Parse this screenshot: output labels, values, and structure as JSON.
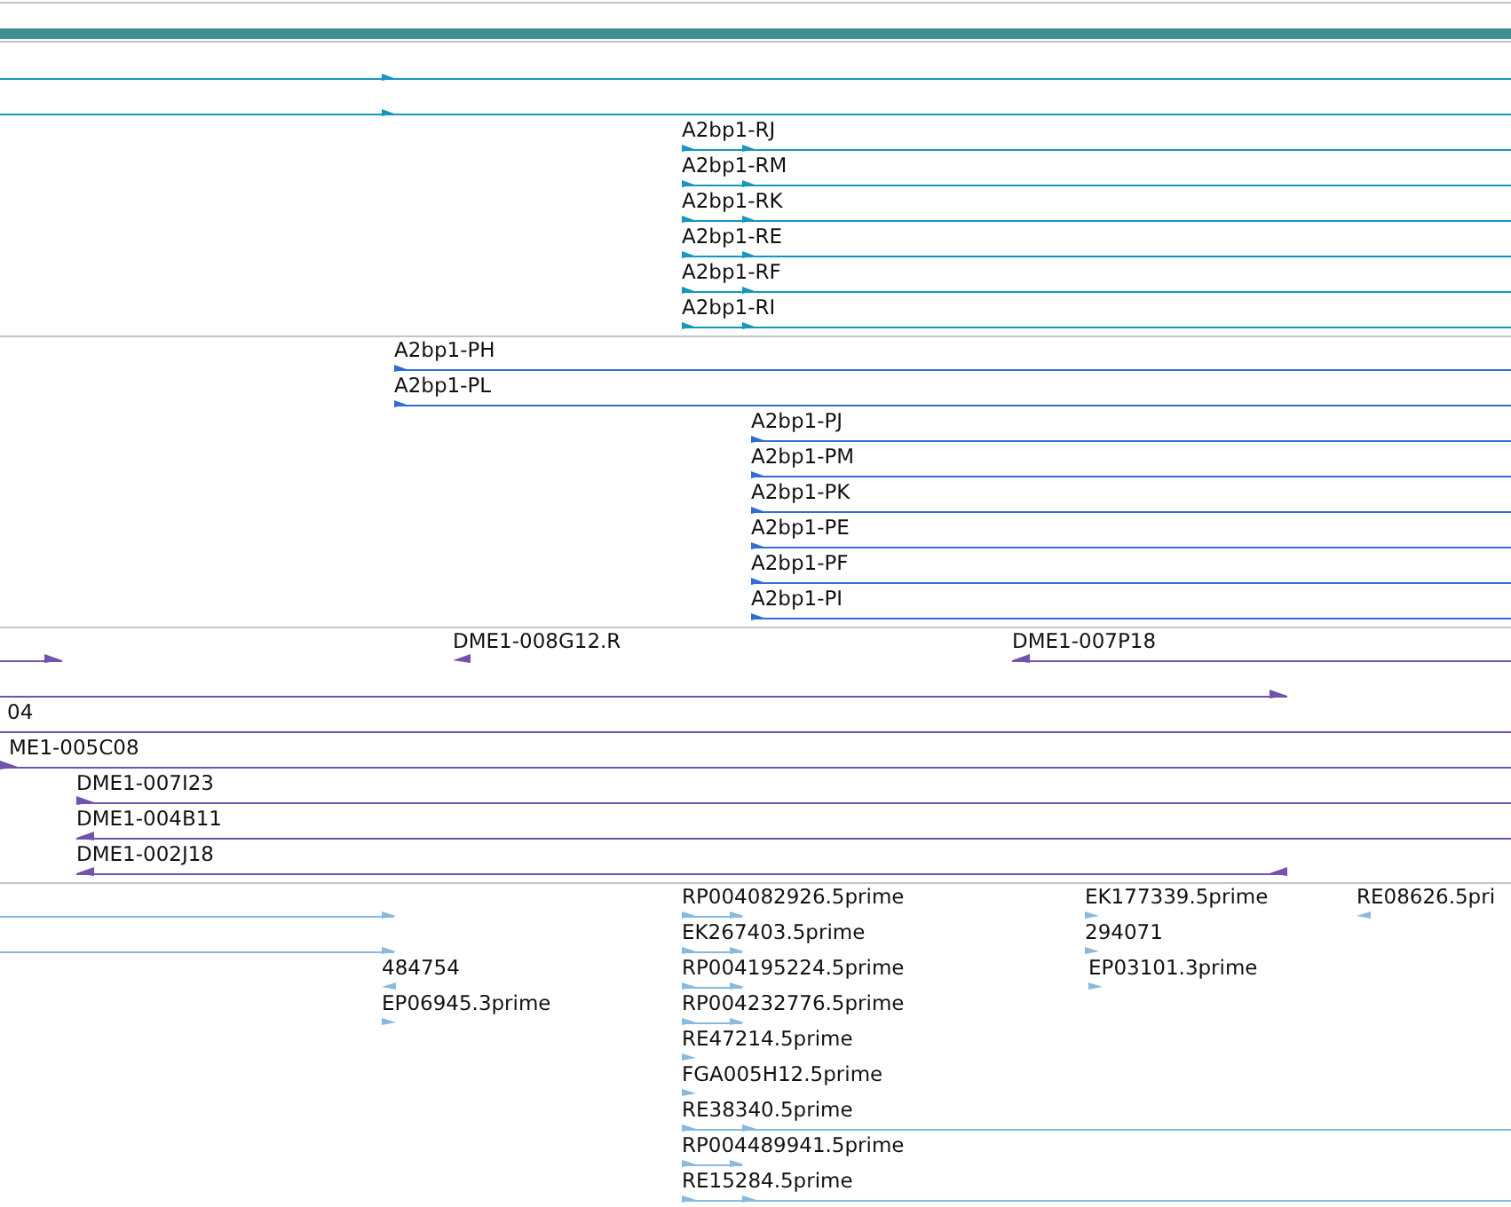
{
  "tracks": [
    {
      "color": "#1597bf",
      "rows": [
        {
          "features": [
            {
              "reverse": false
            }
          ]
        },
        {
          "features": [
            {
              "reverse": false
            }
          ]
        },
        {
          "features": [
            {
              "label": "A2bp1-RJ",
              "reverse": false
            }
          ]
        },
        {
          "features": [
            {
              "label": "A2bp1-RM",
              "reverse": false
            }
          ]
        },
        {
          "features": [
            {
              "label": "A2bp1-RK",
              "reverse": false
            }
          ]
        },
        {
          "features": [
            {
              "label": "A2bp1-RE",
              "reverse": false
            }
          ]
        },
        {
          "features": [
            {
              "label": "A2bp1-RF",
              "reverse": false
            }
          ]
        },
        {
          "features": [
            {
              "label": "A2bp1-RI",
              "reverse": false
            }
          ]
        }
      ]
    },
    {
      "color": "#2f6fd2",
      "rows": [
        {
          "features": [
            {
              "label": "A2bp1-PH",
              "reverse": false
            }
          ]
        },
        {
          "features": [
            {
              "label": "A2bp1-PL",
              "reverse": false
            }
          ]
        },
        {
          "features": [
            {
              "label": "A2bp1-PJ",
              "reverse": false
            }
          ]
        },
        {
          "features": [
            {
              "label": "A2bp1-PM",
              "reverse": false
            }
          ]
        },
        {
          "features": [
            {
              "label": "A2bp1-PK",
              "reverse": false
            }
          ]
        },
        {
          "features": [
            {
              "label": "A2bp1-PE",
              "reverse": false
            }
          ]
        },
        {
          "features": [
            {
              "label": "A2bp1-PF",
              "reverse": false
            }
          ]
        },
        {
          "features": [
            {
              "label": "A2bp1-PI",
              "reverse": false
            }
          ]
        }
      ]
    },
    {
      "color": "#7352ad",
      "rows": [
        {
          "features": [
            {
              "reverse": false
            },
            {
              "label": "DME1-008G12.R",
              "reverse": true
            },
            {
              "label": "DME1-007P18",
              "reverse": true
            }
          ]
        },
        {
          "features": [
            {
              "reverse": false
            }
          ]
        },
        {
          "features": [
            {
              "label": "04"
            }
          ]
        },
        {
          "features": [
            {
              "label": "ME1-005C08",
              "reverse": false
            }
          ]
        },
        {
          "features": [
            {
              "label": "DME1-007I23",
              "reverse": false
            }
          ]
        },
        {
          "features": [
            {
              "label": "DME1-004B11",
              "reverse": true
            }
          ]
        },
        {
          "features": [
            {
              "label": "DME1-002J18",
              "reverse": true
            }
          ]
        }
      ]
    },
    {
      "color": "#8ab9e0",
      "rows": [
        {
          "features": [
            {
              "reverse": false
            },
            {
              "label": "RP004082926.5prime",
              "reverse": false
            },
            {
              "label": "EK177339.5prime",
              "reverse": false
            },
            {
              "label": "RE08626.5pri",
              "reverse": true
            }
          ]
        },
        {
          "features": [
            {
              "reverse": false
            },
            {
              "label": "EK267403.5prime",
              "reverse": false
            },
            {
              "label": "294071",
              "reverse": false
            }
          ]
        },
        {
          "features": [
            {
              "label": "484754",
              "reverse": true
            },
            {
              "label": "RP004195224.5prime",
              "reverse": false
            },
            {
              "label": "EP03101.3prime",
              "reverse": false
            }
          ]
        },
        {
          "features": [
            {
              "label": "EP06945.3prime",
              "reverse": false
            },
            {
              "label": "RP004232776.5prime",
              "reverse": false
            }
          ]
        },
        {
          "features": [
            {
              "label": "RE47214.5prime",
              "reverse": false
            }
          ]
        },
        {
          "features": [
            {
              "label": "FGA005H12.5prime",
              "reverse": false
            }
          ]
        },
        {
          "features": [
            {
              "label": "RE38340.5prime",
              "reverse": false
            }
          ]
        },
        {
          "features": [
            {
              "label": "RP004489941.5prime",
              "reverse": false
            }
          ]
        },
        {
          "features": [
            {
              "label": "RE15284.5prime",
              "reverse": false
            }
          ]
        }
      ]
    }
  ]
}
